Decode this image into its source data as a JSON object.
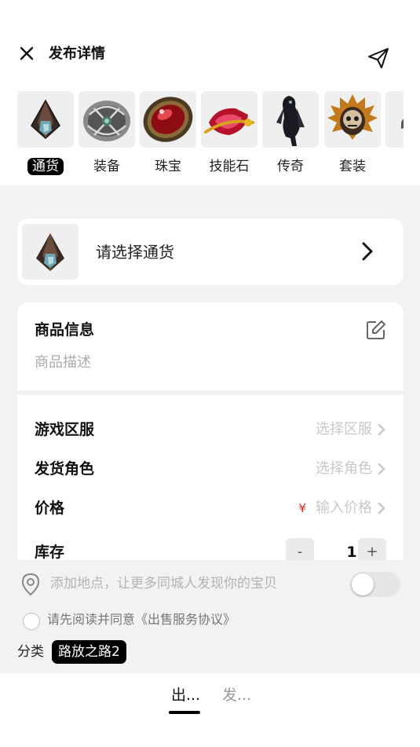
{
  "header": {
    "title": "发布详情",
    "close_icon": "close-icon",
    "send_icon": "send-icon"
  },
  "categories": [
    {
      "label": "通货",
      "icon": "currency-gem-icon",
      "selected": true
    },
    {
      "label": "装备",
      "icon": "equipment-icon",
      "selected": false
    },
    {
      "label": "珠宝",
      "icon": "jewel-icon",
      "selected": false
    },
    {
      "label": "技能石",
      "icon": "skill-gem-icon",
      "selected": false
    },
    {
      "label": "传奇",
      "icon": "legendary-icon",
      "selected": false
    },
    {
      "label": "套装",
      "icon": "set-icon",
      "selected": false
    }
  ],
  "currency_select": {
    "placeholder": "请选择通货",
    "icon": "chevron-right-icon"
  },
  "product_info": {
    "title": "商品信息",
    "description_placeholder": "商品描述",
    "edit_icon": "edit-icon"
  },
  "form": {
    "server": {
      "label": "游戏区服",
      "placeholder": "选择区服"
    },
    "role": {
      "label": "发货角色",
      "placeholder": "选择角色"
    },
    "price": {
      "label": "价格",
      "currency_symbol": "¥",
      "placeholder": "输入价格"
    },
    "stock": {
      "label": "库存",
      "minus": "-",
      "value": "1",
      "plus": "+"
    }
  },
  "location": {
    "text": "添加地点，让更多同城人发现你的宝贝",
    "toggle_on": false
  },
  "agreement": {
    "text": "请先阅读并同意《出售服务协议》",
    "checked": false
  },
  "classification": {
    "label": "分类",
    "value": "路放之路2"
  },
  "bottom_tabs": [
    {
      "label": "出...",
      "active": true
    },
    {
      "label": "发...",
      "active": false
    }
  ],
  "colors": {
    "accent": "#000000",
    "price_symbol": "#e0241d",
    "placeholder": "#c8c8c8",
    "background": "#f2f2f2"
  }
}
